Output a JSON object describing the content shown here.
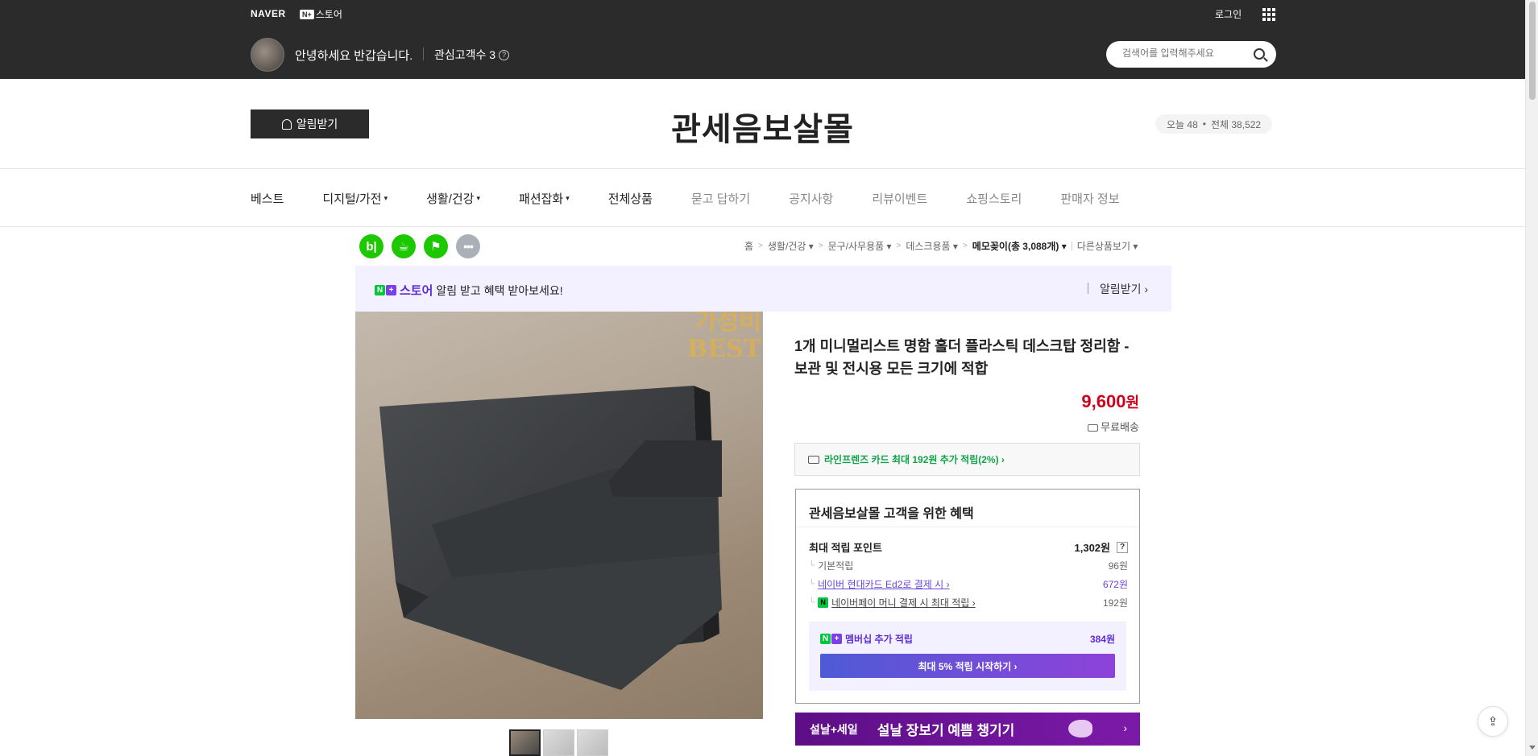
{
  "topbar": {
    "naver": "NAVER",
    "nplus_badge": "N+",
    "nplus_store": "스토어",
    "login": "로그인",
    "greeting": "안녕하세요 반갑습니다.",
    "fans": "관심고객수 3",
    "search_placeholder": "검색어를 입력해주세요"
  },
  "header": {
    "alarm_button": "알림받기",
    "store_name": "관세음보살몰",
    "today": "오늘 48",
    "total": "전체 38,522"
  },
  "nav": {
    "items": [
      {
        "label": "베스트",
        "caret": ""
      },
      {
        "label": "디지털/가전",
        "caret": "▾"
      },
      {
        "label": "생활/건강",
        "caret": "▾"
      },
      {
        "label": "패션잡화",
        "caret": "▾"
      },
      {
        "label": "전체상품",
        "caret": ""
      },
      {
        "label": "묻고 답하기",
        "caret": ""
      },
      {
        "label": "공지사항",
        "caret": ""
      },
      {
        "label": "리뷰이벤트",
        "caret": ""
      },
      {
        "label": "쇼핑스토리",
        "caret": ""
      },
      {
        "label": "판매자 정보",
        "caret": ""
      }
    ]
  },
  "social": {
    "blog": "b|",
    "more": "•••"
  },
  "breadcrumb": {
    "home": "홈",
    "c1": "생활/건강",
    "c2": "문구/사무용품",
    "c3": "데스크용품",
    "current": "메모꽂이(총 3,088개)",
    "other": "다른상품보기"
  },
  "notice": {
    "store": "스토어",
    "text": "알림 받고 혜택 받아보세요!",
    "alarm": "알림받기 ›"
  },
  "image": {
    "overlay_line1": "가성비",
    "overlay_line2": "BEST"
  },
  "product": {
    "title": "1개 미니멀리스트 명함 홀더 플라스틱 데스크탑 정리함 - 보관 및 전시용 모든 크기에 적합",
    "price": "9,600",
    "price_unit": "원",
    "shipping": "무료배송",
    "card_offer": "라인프렌즈 카드 최대 192원 추가 적립(2%) ›"
  },
  "benefit": {
    "heading": "관세음보살몰 고객을 위한 혜택",
    "max_label": "최대 적립 포인트",
    "max_value": "1,302원",
    "help": "?",
    "basic_label": "기본적립",
    "basic_value": "96원",
    "card_label": "네이버 현대카드 Ed2로 결제 시",
    "card_value": "672원",
    "pay_label": "네이버페이 머니 결제 시 최대 적립",
    "pay_value": "192원",
    "member_label": "멤버십 추가 적립",
    "member_value": "384원",
    "member_button": "최대 5% 적립 시작하기 ›"
  },
  "promo": {
    "tag": "설날+세일",
    "text": "설날 장보기 예쁨 챙기기",
    "chev": "›"
  },
  "colors": {
    "price": "#d0021b",
    "purple": "#5b2ed6",
    "green": "#00c73c"
  }
}
